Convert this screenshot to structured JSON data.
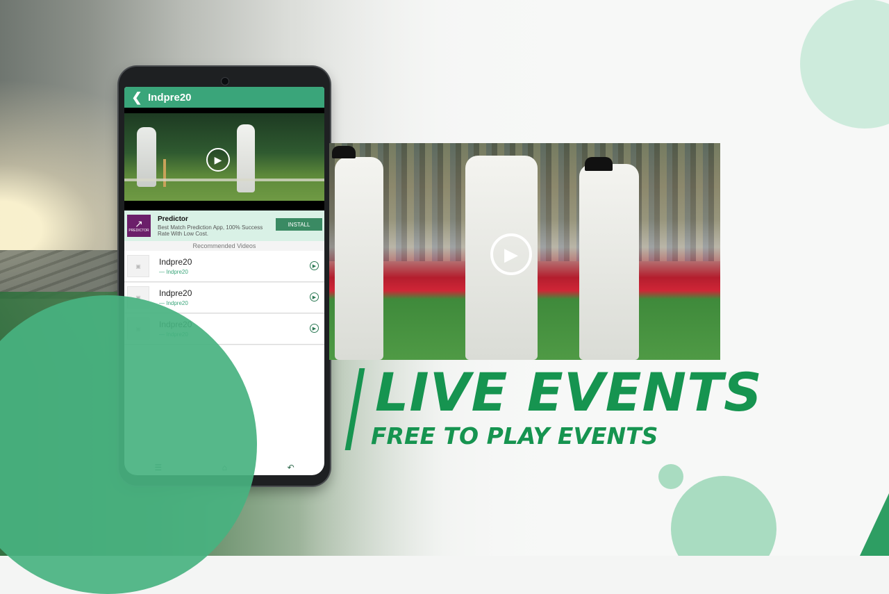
{
  "app": {
    "title": "Indpre20",
    "video_play_icon": "play-circle-icon"
  },
  "ad": {
    "name": "Predictor",
    "description": "Best Match Prediction App, 100% Success Rate With Low Cost.",
    "logo_text": "PREDICTOR",
    "install_label": "INSTALL"
  },
  "recommended": {
    "label": "Recommended Videos",
    "items": [
      {
        "title": "Indpre20",
        "subtitle": "— Indpre20"
      },
      {
        "title": "Indpre20",
        "subtitle": "— Indpre20"
      },
      {
        "title": "Indpre20",
        "subtitle": "— Indpre20"
      }
    ]
  },
  "navbar": {
    "icons": [
      "menu-icon",
      "home-icon",
      "back-icon"
    ]
  },
  "promo": {
    "headline": "LIVE EVENTS",
    "subheadline": "FREE TO PLAY EVENTS"
  },
  "colors": {
    "brand_green": "#169450",
    "app_bar": "#3aa57a",
    "install_button": "#3a8a63",
    "circle_green": "#5bbd8e",
    "ad_logo": "#6b1f6a"
  }
}
